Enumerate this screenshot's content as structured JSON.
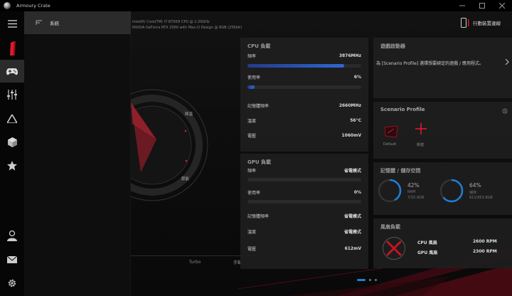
{
  "window": {
    "title": "Armoury Crate"
  },
  "flyout": {
    "items": [
      {
        "label": "系統"
      }
    ]
  },
  "header": {
    "cpu_spec": "Intel(R) Core(TM) i7-8750H CPU @ 2.20GHz",
    "gpu_spec": "NVIDIA GeForce RTX 2060 with Max-Q Design @ 8GB (256bit)",
    "device_link": "行動裝置連線"
  },
  "gauge": {
    "labels": [
      "降溫",
      "節能"
    ]
  },
  "modes": {
    "tabs": [
      "",
      "Turbo",
      "手動"
    ]
  },
  "cpu": {
    "title": "CPU 負載",
    "freq_label": "頻率",
    "freq_value": "3876MHz",
    "usage_label": "使用率",
    "usage_value": "6%",
    "usage_fraction": 0.06,
    "mem_freq_label": "記憶體頻率",
    "mem_freq_value": "2660MHz",
    "temp_label": "溫度",
    "temp_value": "56°C",
    "volt_label": "電壓",
    "volt_value": "1060mV",
    "freq_fraction": 0.85
  },
  "gpu": {
    "title": "GPU 負載",
    "freq_label": "頻率",
    "freq_value": "省電模式",
    "usage_label": "使用率",
    "usage_value": "0%",
    "mem_freq_label": "記憶體頻率",
    "mem_freq_value": "省電模式",
    "temp_label": "溫度",
    "temp_value": "省電模式",
    "volt_label": "電壓",
    "volt_value": "612mV"
  },
  "game_panel": {
    "title": "遊戲啟動器",
    "message": "為 [Scenario Profile] 選擇想要綁定的遊戲 / 應用程式。"
  },
  "scenario": {
    "title": "Scenario Profile",
    "default_label": "Default",
    "add_label": "新建"
  },
  "memory": {
    "title": "記憶體 / 儲存空間",
    "ram_percent": "42%",
    "ram_label": "RAM",
    "ram_detail": "7/15.9GB",
    "ram_fraction": 0.42,
    "disk_percent": "64%",
    "disk_label": "儲存",
    "disk_detail": "611/952.8GB",
    "disk_fraction": 0.64
  },
  "fans": {
    "title": "風扇負載",
    "cpu_label": "CPU 風扇",
    "cpu_value": "2600 RPM",
    "gpu_label": "GPU 風扇",
    "gpu_value": "2300 RPM"
  },
  "colors": {
    "accent": "#e01a2b",
    "blue": "#1f7fd6",
    "panel": "#1e1e1e"
  }
}
